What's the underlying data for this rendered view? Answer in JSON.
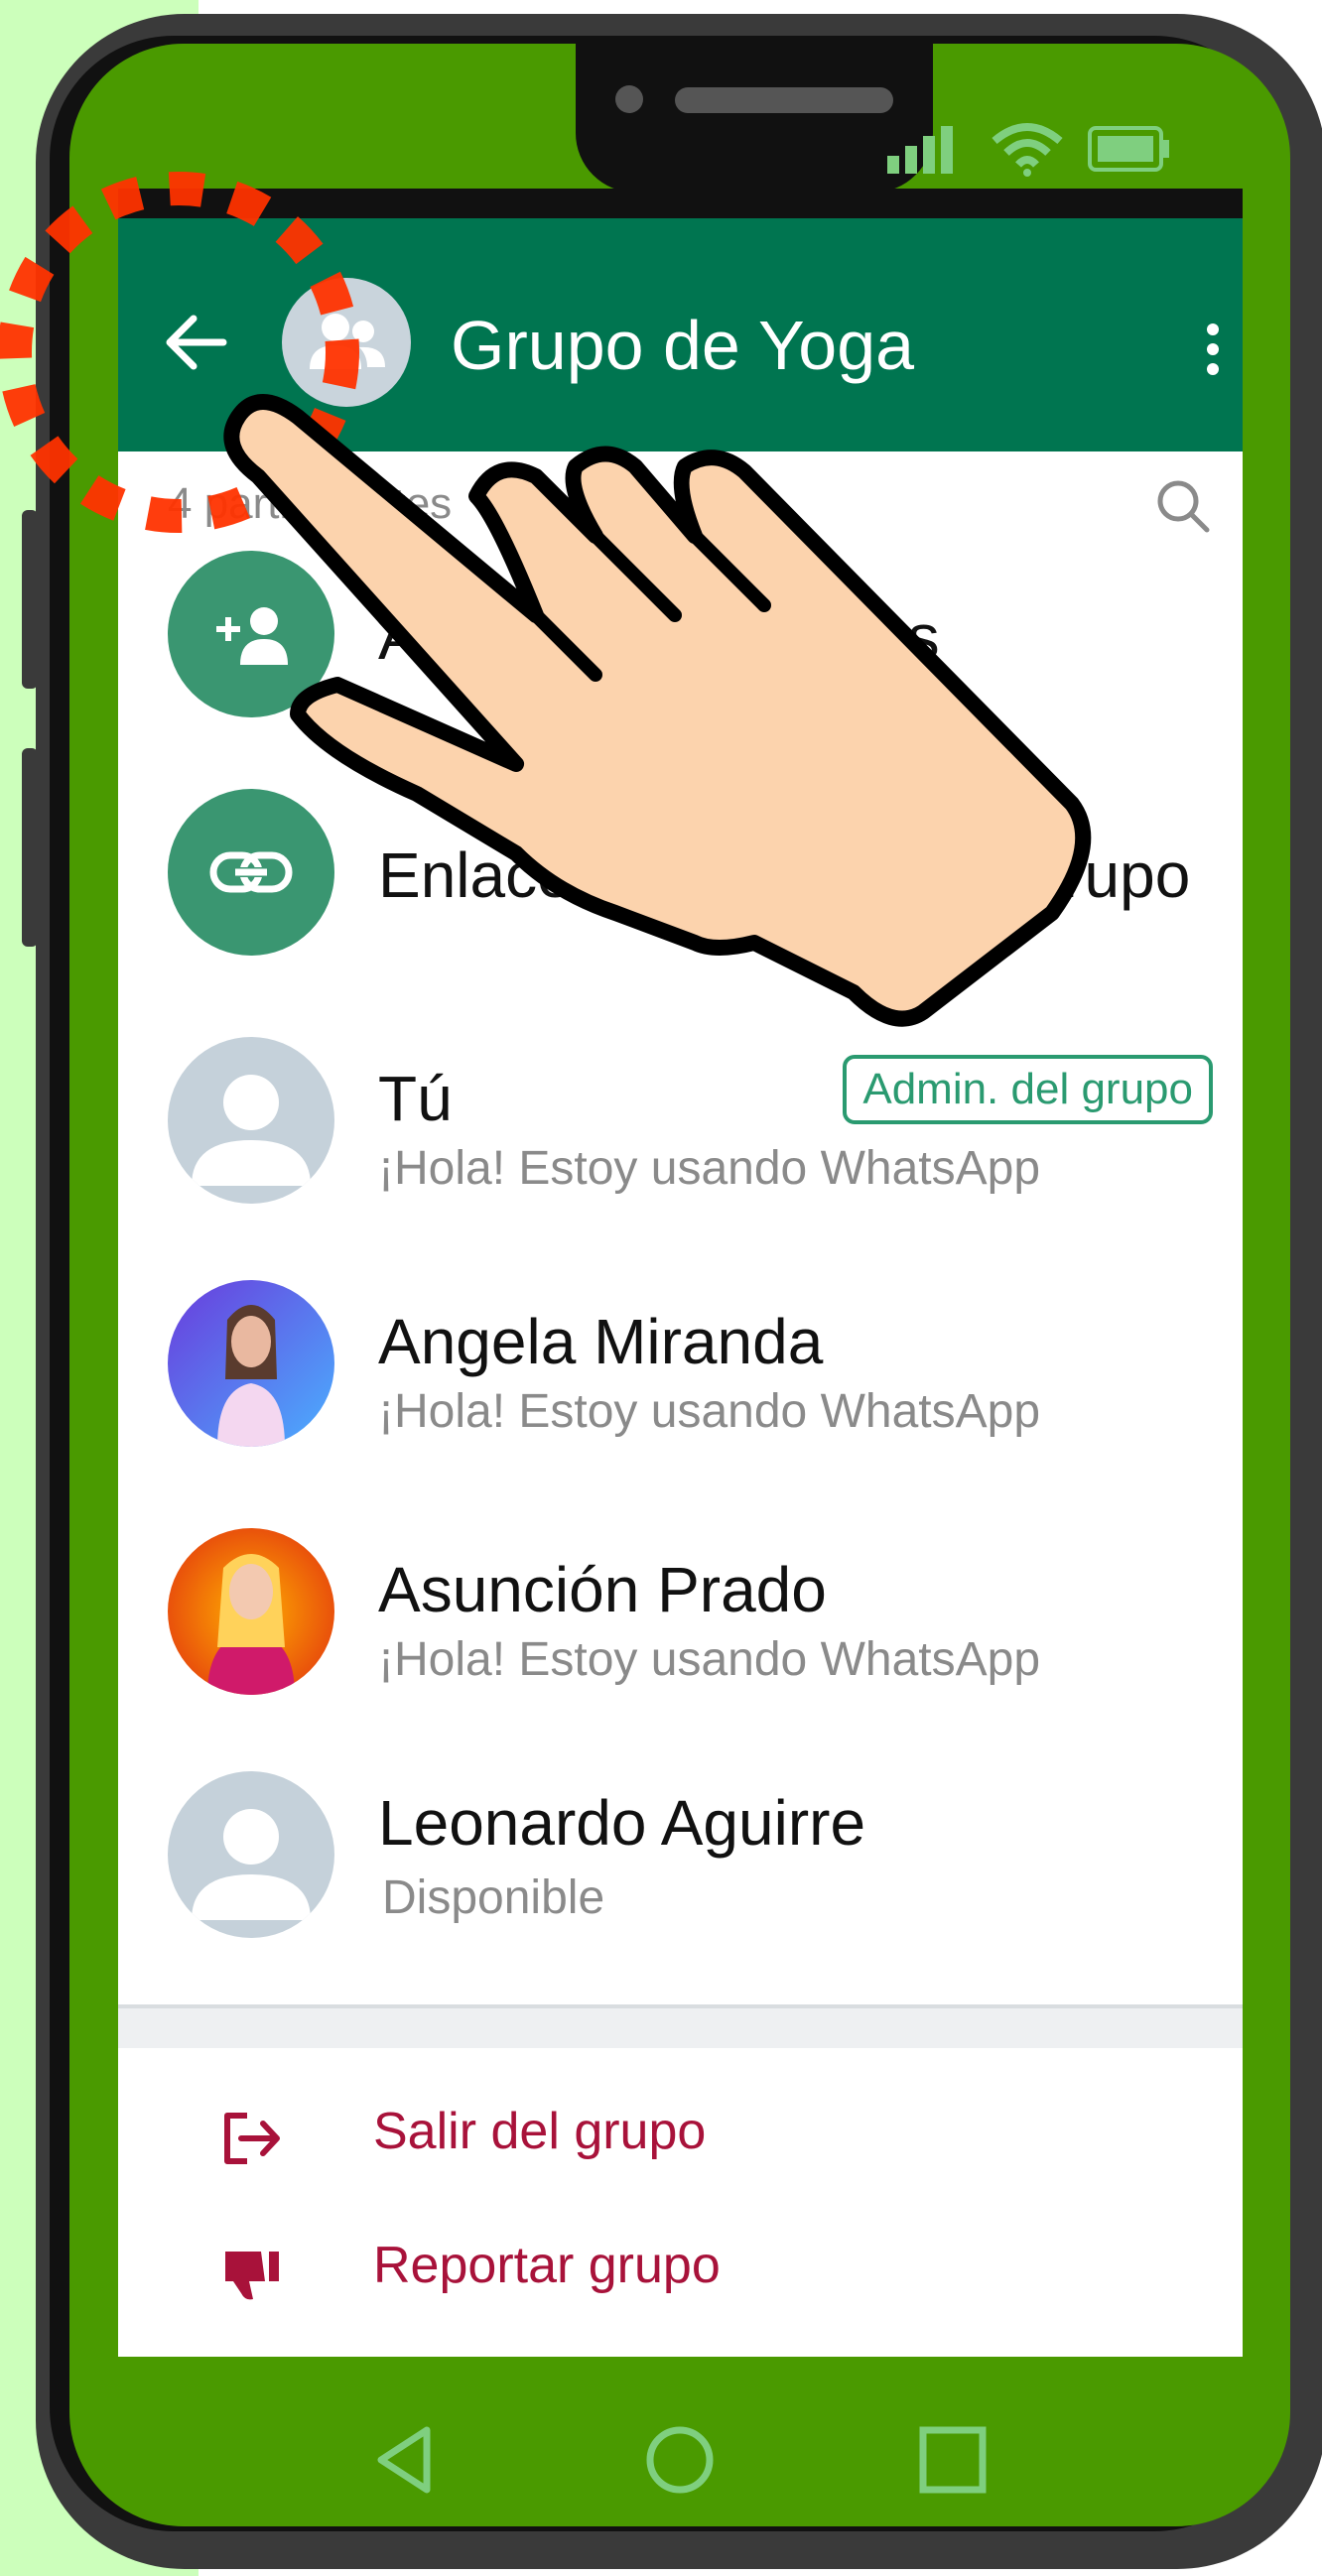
{
  "colors": {
    "header": "#007550",
    "accent": "#2a9a70",
    "danger": "#a8123a",
    "phone_bezel": "#4a9a00",
    "highlight": "#ff3300"
  },
  "header": {
    "title": "Grupo de Yoga",
    "back_icon": "arrow-left-icon",
    "avatar_icon": "group-icon",
    "menu_icon": "more-vert-icon"
  },
  "participants": {
    "count_label": "4 participantes",
    "search_icon": "search-icon"
  },
  "actions_top": [
    {
      "label": "Añadir participantes",
      "icon": "add-person-icon"
    },
    {
      "label": "Enlace de invitación al grupo",
      "icon": "link-icon"
    }
  ],
  "members": [
    {
      "name": "Tú",
      "status": "¡Hola! Estoy usando WhatsApp",
      "badge": "Admin. del grupo"
    },
    {
      "name": "Angela Miranda",
      "status": "¡Hola! Estoy usando WhatsApp"
    },
    {
      "name": "Asunción Prado",
      "status": "¡Hola! Estoy usando WhatsApp"
    },
    {
      "name": "Leonardo Aguirre",
      "status": "Disponible"
    }
  ],
  "actions_bottom": [
    {
      "label": "Salir del grupo",
      "icon": "exit-icon"
    },
    {
      "label": "Reportar grupo",
      "icon": "thumbs-down-icon"
    }
  ],
  "navbar": {
    "back_icon": "nav-back-icon",
    "home_icon": "nav-home-icon",
    "recents_icon": "nav-recents-icon"
  }
}
